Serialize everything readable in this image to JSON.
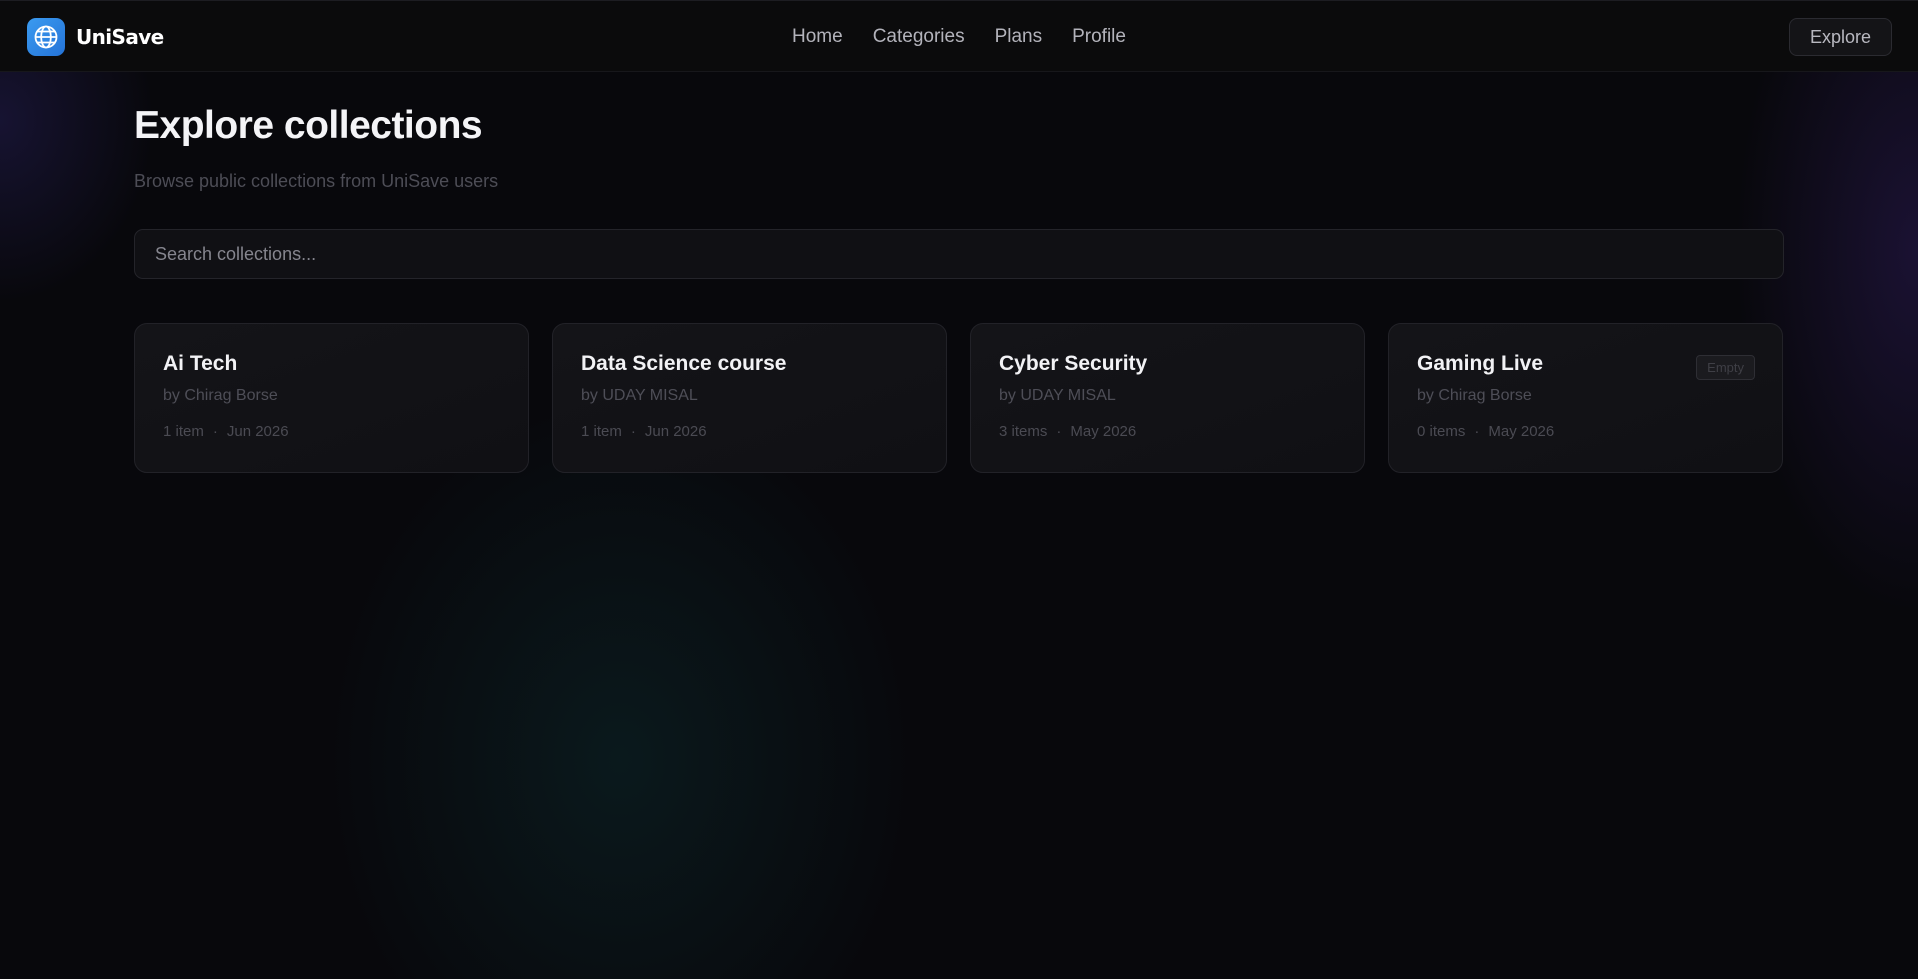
{
  "app": {
    "name": "UniSave",
    "logo_icon": "globe-icon",
    "accent": "#2f86e6"
  },
  "nav": {
    "links": [
      "Home",
      "Categories",
      "Plans",
      "Profile"
    ],
    "explore_label": "Explore"
  },
  "main": {
    "title": "Explore collections",
    "subtitle": "Browse public collections from UniSave users",
    "search": {
      "placeholder": "Search collections...",
      "value": ""
    },
    "collections": [
      {
        "title": "Ai Tech",
        "owner": "by Chirag Borse",
        "items": "1 item",
        "separator": "·",
        "date": "Jun 2026",
        "badge": ""
      },
      {
        "title": "Data Science course",
        "owner": "by UDAY MISAL",
        "items": "1 item",
        "separator": "·",
        "date": "Jun 2026",
        "badge": ""
      },
      {
        "title": "Cyber Security",
        "owner": "by UDAY MISAL",
        "items": "3 items",
        "separator": "·",
        "date": "May 2026",
        "badge": ""
      },
      {
        "title": "Gaming Live",
        "owner": "by Chirag Borse",
        "items": "0 items",
        "separator": "·",
        "date": "May 2026",
        "badge": "Empty"
      }
    ]
  }
}
